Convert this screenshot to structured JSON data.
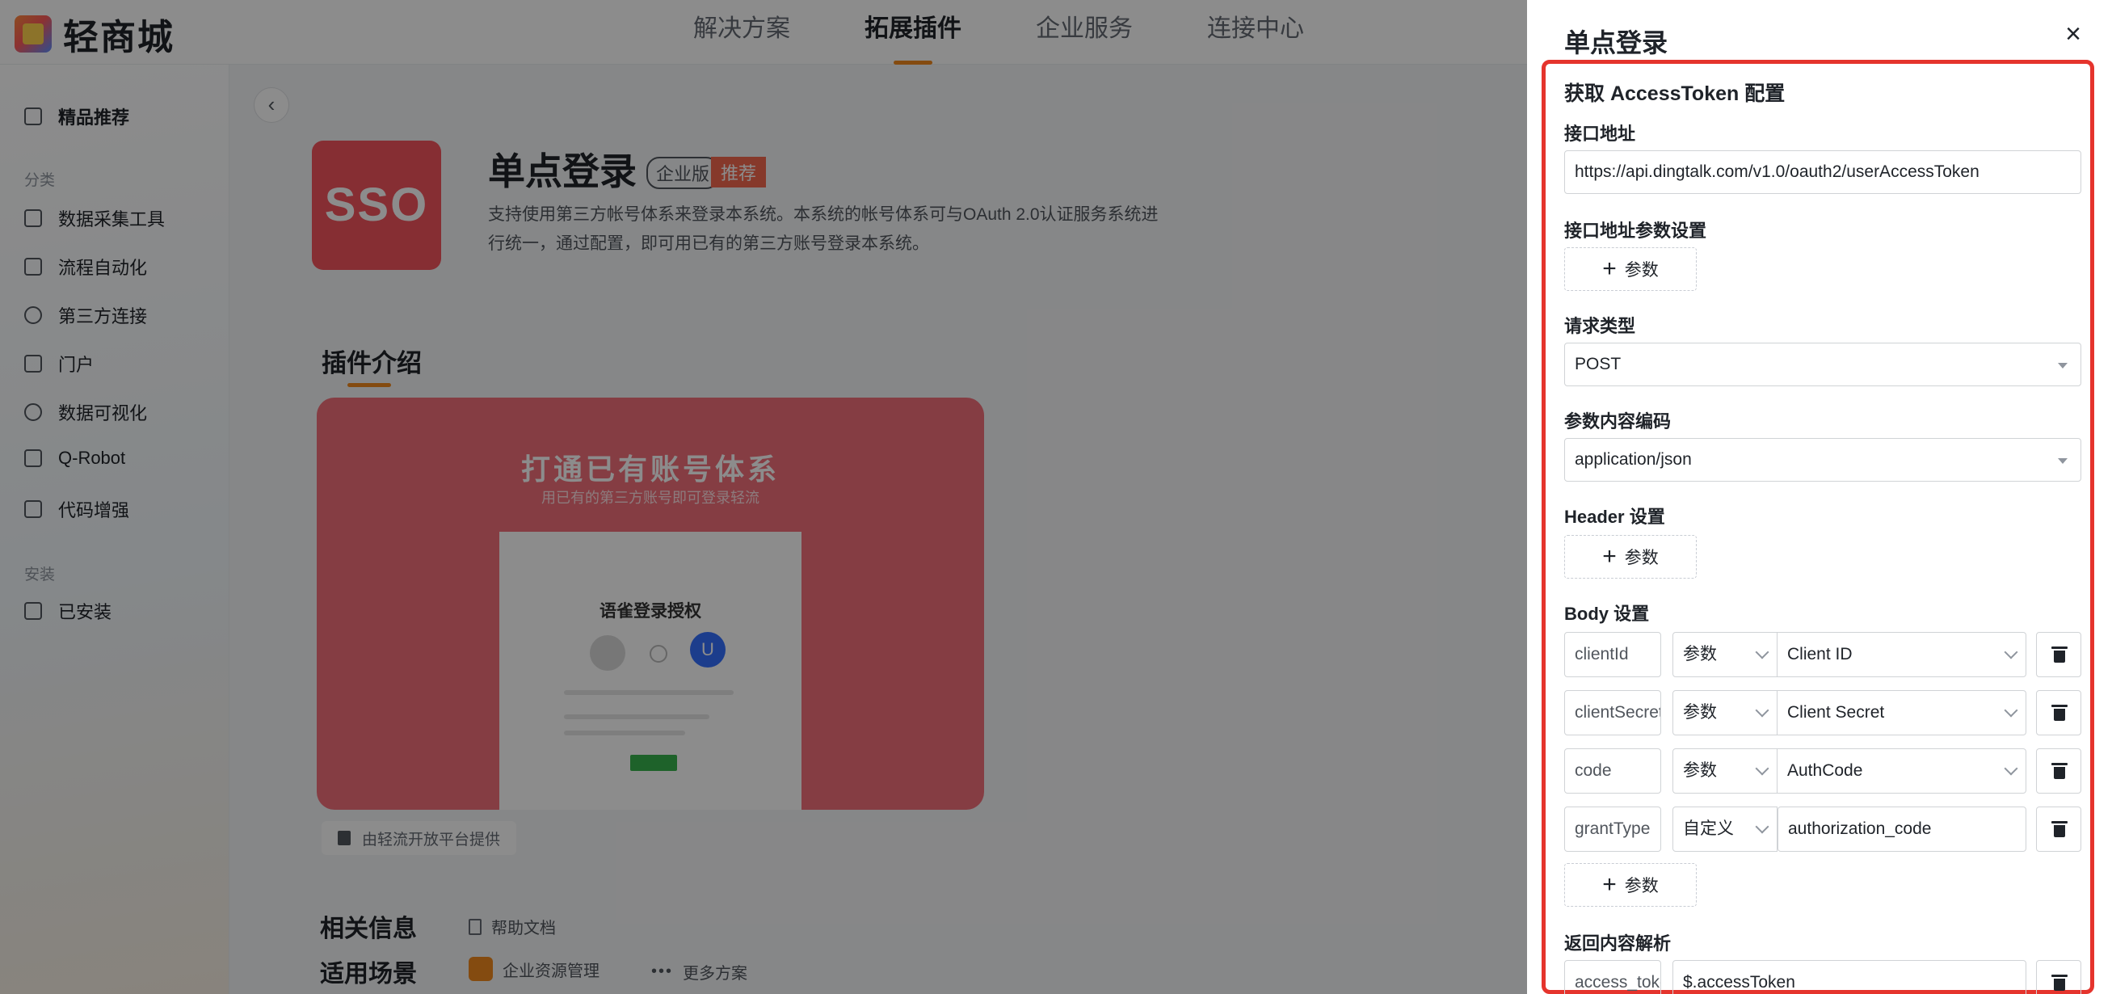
{
  "header": {
    "logo_text": "轻商城",
    "nav": [
      {
        "label": "解决方案"
      },
      {
        "label": "拓展插件"
      },
      {
        "label": "企业服务"
      },
      {
        "label": "连接中心"
      }
    ],
    "active_nav": "拓展插件"
  },
  "sidebar": {
    "featured": "精品推荐",
    "category_label": "分类",
    "categories": [
      {
        "label": "数据采集工具",
        "icon": "form-icon"
      },
      {
        "label": "流程自动化",
        "icon": "flow-icon"
      },
      {
        "label": "第三方连接",
        "icon": "link-icon"
      },
      {
        "label": "门户",
        "icon": "portal-icon"
      },
      {
        "label": "数据可视化",
        "icon": "chart-icon"
      },
      {
        "label": "Q-Robot",
        "icon": "robot-icon"
      },
      {
        "label": "代码增强",
        "icon": "code-icon"
      }
    ],
    "installed_label": "安装",
    "installed": "已安装"
  },
  "plugin": {
    "logo_text": "SSO",
    "title": "单点登录",
    "tag_edition": "企业版",
    "tag_recommend": "推荐",
    "description": "支持使用第三方帐号体系来登录本系统。本系统的帐号体系可与OAuth 2.0认证服务系统进行统一，通过配置，即可用已有的第三方账号登录本系统。",
    "intro_heading": "插件介绍",
    "banner_title": "打通已有账号体系",
    "banner_subtitle": "用已有的第三方账号即可登录轻流",
    "banner_card_title": "语雀登录授权",
    "banner_avatar_letter": "U",
    "provider": "由轻流开放平台提供",
    "related_heading": "相关信息",
    "help_doc": "帮助文档",
    "scenario_heading": "适用场景",
    "scenario_tag": "企业资源管理",
    "more_solutions": "更多方案"
  },
  "drawer": {
    "title": "单点登录",
    "section_title": "获取 AccessToken 配置",
    "api_url_label": "接口地址",
    "api_url_value": "https://api.dingtalk.com/v1.0/oauth2/userAccessToken",
    "url_params_label": "接口地址参数设置",
    "add_param_label": "参数",
    "request_type_label": "请求类型",
    "request_type_value": "POST",
    "encoding_label": "参数内容编码",
    "encoding_value": "application/json",
    "header_label": "Header 设置",
    "body_label": "Body 设置",
    "body_rows": [
      {
        "key": "clientId",
        "type": "参数",
        "value": "Client ID"
      },
      {
        "key": "clientSecret",
        "type": "参数",
        "value": "Client Secret"
      },
      {
        "key": "code",
        "type": "参数",
        "value": "AuthCode"
      },
      {
        "key": "grantType",
        "type": "自定义",
        "value": "authorization_code"
      }
    ],
    "response_label": "返回内容解析",
    "response_rows": [
      {
        "key": "access_token",
        "value": "$.accessToken"
      }
    ]
  },
  "colors": {
    "accent": "#f0891e",
    "highlight_border": "#e5342d",
    "sso_logo": "#f5545d"
  }
}
